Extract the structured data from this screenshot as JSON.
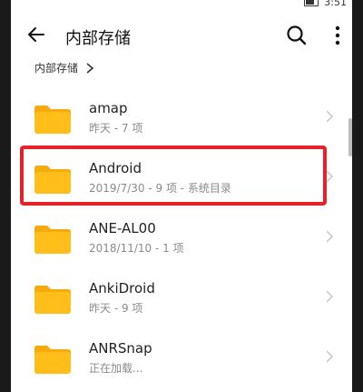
{
  "status_bar": {
    "time": "3:51"
  },
  "header": {
    "title": "内部存储"
  },
  "breadcrumb": {
    "items": [
      "内部存储"
    ]
  },
  "folders": [
    {
      "name": "amap",
      "meta": "昨天 - 7 项"
    },
    {
      "name": "Android",
      "meta": "2019/7/30 - 9 项 - 系统目录"
    },
    {
      "name": "ANE-AL00",
      "meta": "2018/11/10 - 1 项"
    },
    {
      "name": "AnkiDroid",
      "meta": "昨天 - 9 项"
    },
    {
      "name": "ANRSnap",
      "meta": "正在加载..."
    }
  ],
  "colors": {
    "folder": "#FFBE1A",
    "folder_tab": "#F6AA0E",
    "highlight": "#E8202A",
    "meta_text": "#8A8A8A"
  },
  "icons": {
    "back": "arrow-left-icon",
    "search": "search-icon",
    "more": "more-vertical-icon",
    "folder": "folder-icon",
    "chevron": "chevron-right-icon"
  }
}
